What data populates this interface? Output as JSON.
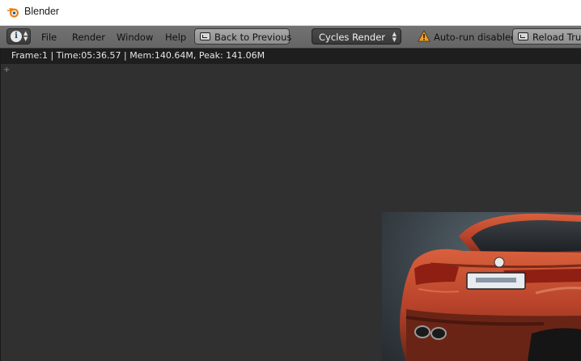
{
  "window": {
    "title": "Blender",
    "app_icon": "blender-logo-icon"
  },
  "header": {
    "editor_type_icon": "info-icon",
    "menu": [
      "File",
      "Render",
      "Window",
      "Help"
    ],
    "back_button_label": "Back to Previous",
    "render_engine": "Cycles Render",
    "warning_icon": "warning-triangle-icon",
    "autorun_status": "Auto-run disabled",
    "reload_button_label": "Reload Trust"
  },
  "render_view": {
    "stats": "Frame:1 | Time:05:36.57 | Mem:140.64M, Peak: 141.06M",
    "image_subject": "red car rear view render"
  },
  "colors": {
    "header_bg": "#6e6e6e",
    "viewport_bg": "#303030",
    "car_paint": "#c24a2e"
  }
}
